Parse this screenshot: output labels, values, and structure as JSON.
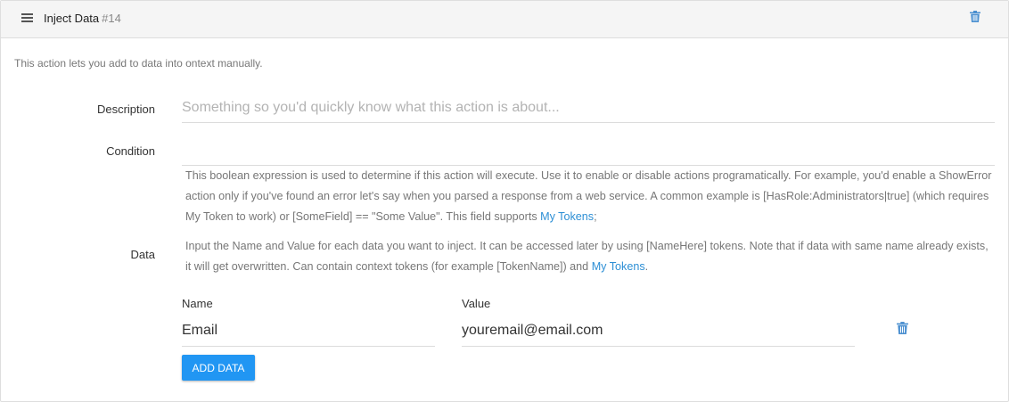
{
  "header": {
    "title": "Inject Data",
    "number": "#14",
    "menu_icon": "hamburger-icon",
    "delete_icon": "trash-icon"
  },
  "intro": "This action lets you add to data into ontext manually.",
  "description": {
    "label": "Description",
    "value": "",
    "placeholder": "Something so you'd quickly know what this action is about..."
  },
  "condition": {
    "label": "Condition",
    "value": "",
    "help_text": "This boolean expression is used to determine if this action will execute. Use it to enable or disable actions programatically. For example, you'd enable a ShowError action only if you've found an error let's say when you parsed a response from a web service. A common example is [HasRole:Administrators|true] (which requires My Token to work) or [SomeField] == \"Some Value\". This field supports ",
    "help_link": "My Tokens",
    "help_suffix": ";"
  },
  "data": {
    "label": "Data",
    "help_text": "Input the Name and Value for each data you want to inject. It can be accessed later by using [NameHere] tokens. Note that if data with same name already exists, it will get overwritten. Can contain context tokens (for example [TokenName]) and ",
    "help_link": "My Tokens",
    "help_suffix": ".",
    "columns": {
      "name": "Name",
      "value": "Value"
    },
    "rows": [
      {
        "name": "Email",
        "value": "youremail@email.com"
      }
    ],
    "add_button": "ADD DATA"
  },
  "colors": {
    "accent": "#2196f3",
    "link": "#2d8fd5",
    "icon": "#4a8fd0"
  }
}
